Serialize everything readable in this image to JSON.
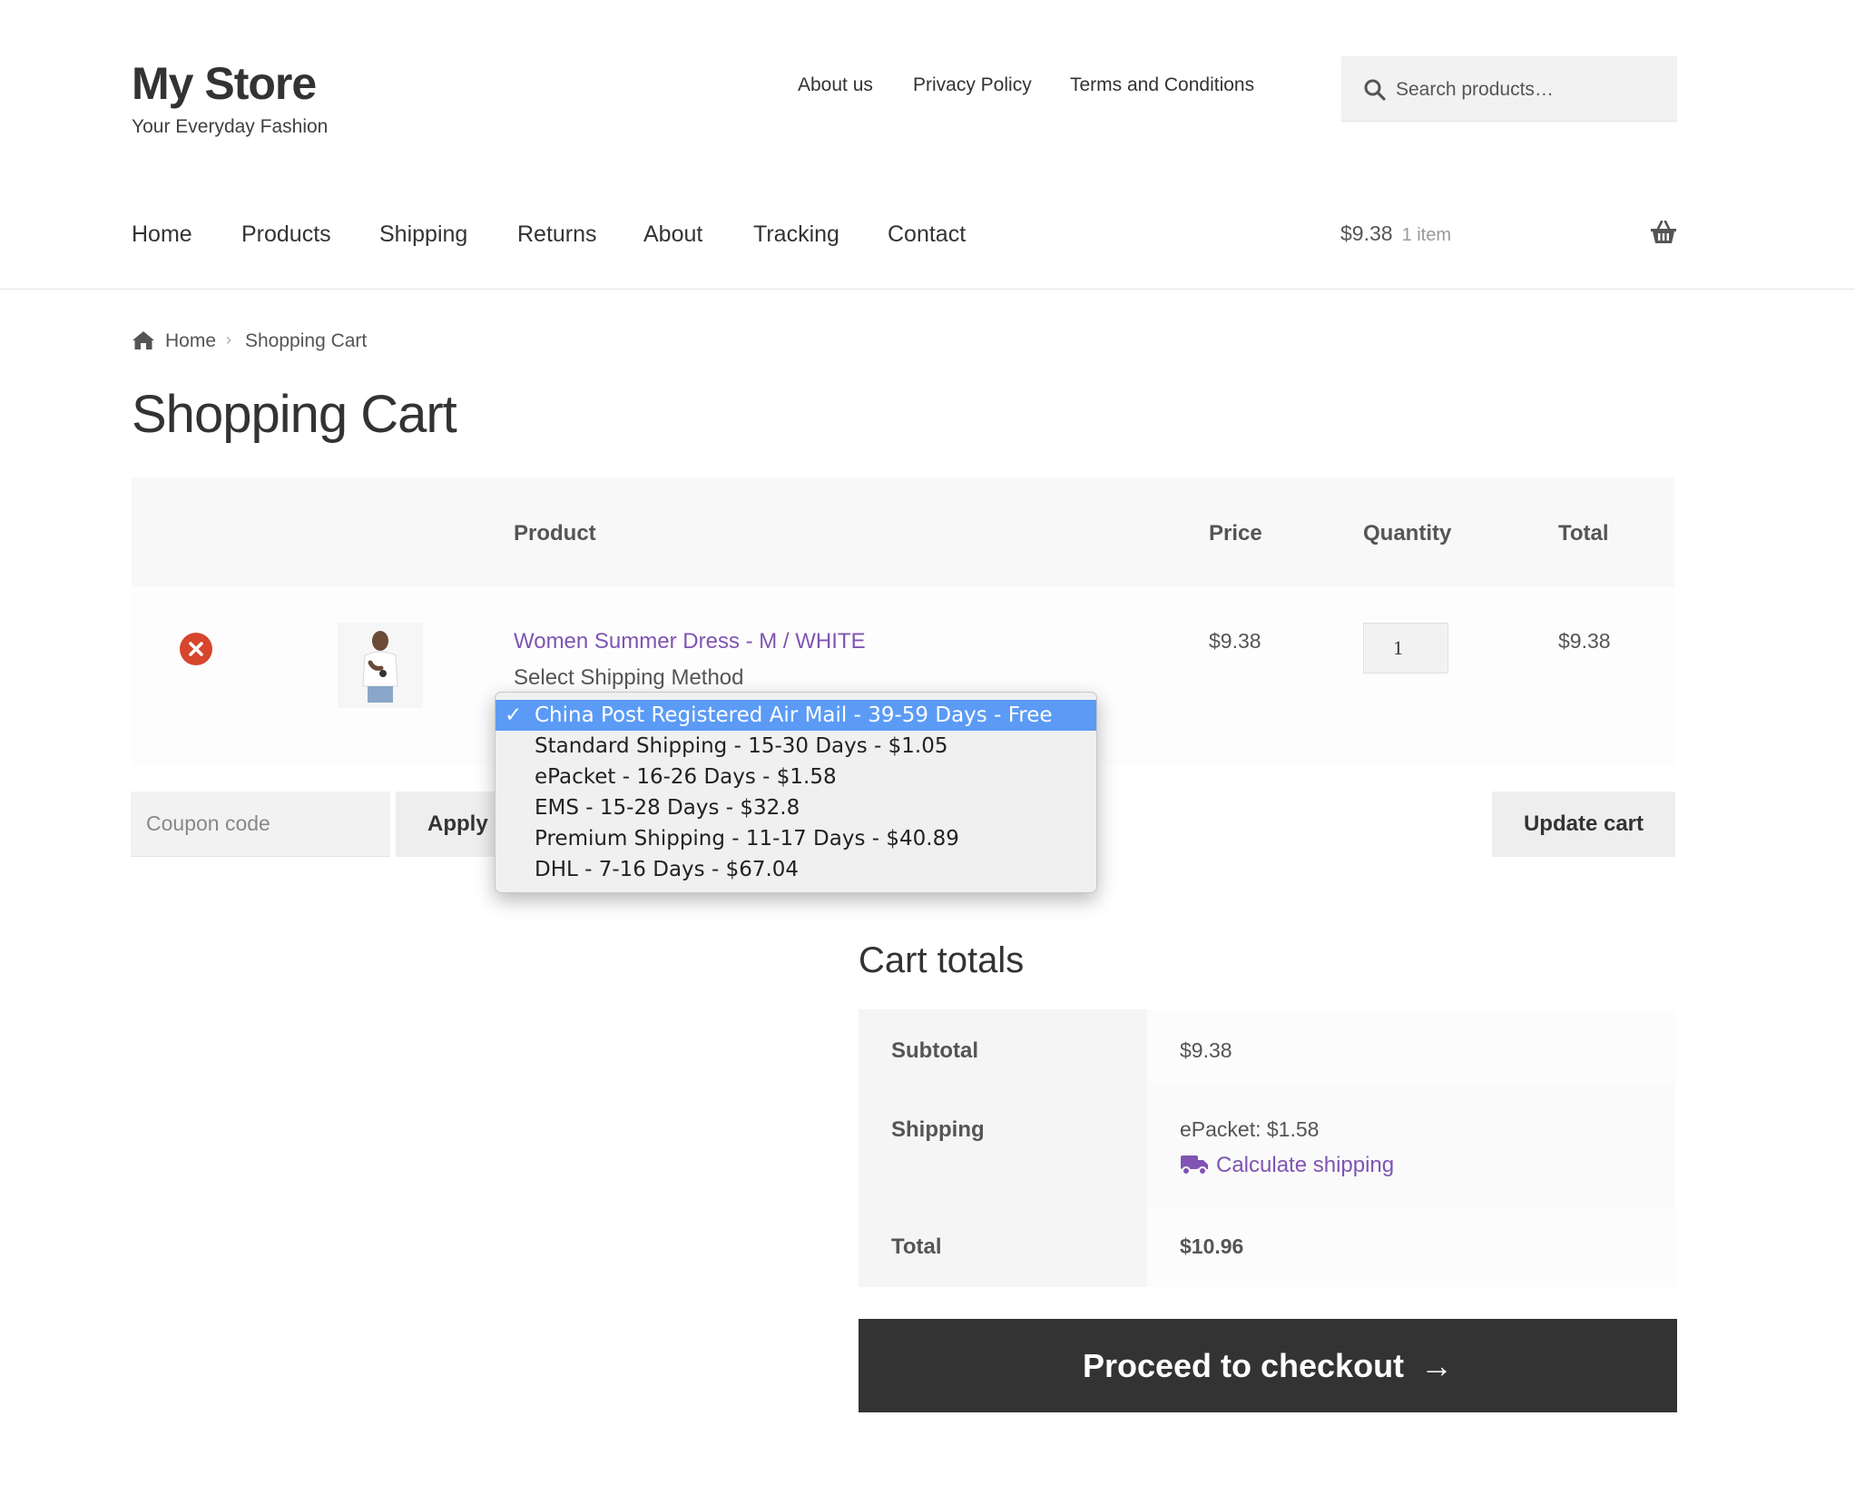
{
  "site": {
    "title": "My Store",
    "description": "Your Everyday Fashion"
  },
  "secondary_nav": [
    "About us",
    "Privacy Policy",
    "Terms and Conditions"
  ],
  "search": {
    "placeholder": "Search products…"
  },
  "main_nav": [
    "Home",
    "Products",
    "Shipping",
    "Returns",
    "About",
    "Tracking",
    "Contact"
  ],
  "header_cart": {
    "amount": "$9.38",
    "count": "1 item"
  },
  "breadcrumb": {
    "home": "Home",
    "separator": "›",
    "current": "Shopping Cart"
  },
  "page_title": "Shopping Cart",
  "cart_table": {
    "headers": {
      "product": "Product",
      "price": "Price",
      "quantity": "Quantity",
      "total": "Total"
    },
    "item": {
      "name": "Women Summer Dress - M / WHITE",
      "shipping_label": "Select Shipping Method",
      "price": "$9.38",
      "quantity": "1",
      "total": "$9.38"
    }
  },
  "shipping_dropdown": {
    "selected_mark": "✓",
    "options": [
      "China Post Registered Air Mail - 39-59 Days - Free",
      "Standard Shipping - 15-30 Days - $1.05",
      "ePacket - 16-26 Days - $1.58",
      "EMS - 15-28 Days - $32.8",
      "Premium Shipping - 11-17 Days - $40.89",
      "DHL - 7-16 Days - $67.04"
    ],
    "selected_index": 0
  },
  "actions": {
    "coupon_placeholder": "Coupon code",
    "apply_label": "Apply coupon",
    "update_label": "Update cart"
  },
  "cart_totals": {
    "title": "Cart totals",
    "subtotal_label": "Subtotal",
    "subtotal_value": "$9.38",
    "shipping_label": "Shipping",
    "shipping_value": "ePacket: $1.58",
    "calculate_label": "Calculate shipping",
    "total_label": "Total",
    "total_value": "$10.96"
  },
  "checkout": {
    "label": "Proceed to checkout",
    "arrow": "→"
  },
  "colors": {
    "link": "#7f54b3",
    "remove": "#d6452c",
    "checkout_bg": "#333333",
    "dropdown_highlight": "#5b9bf5"
  },
  "icons": [
    "search-icon",
    "basket-icon",
    "home-icon",
    "remove-icon",
    "truck-icon",
    "arrow-right-icon",
    "check-icon"
  ]
}
